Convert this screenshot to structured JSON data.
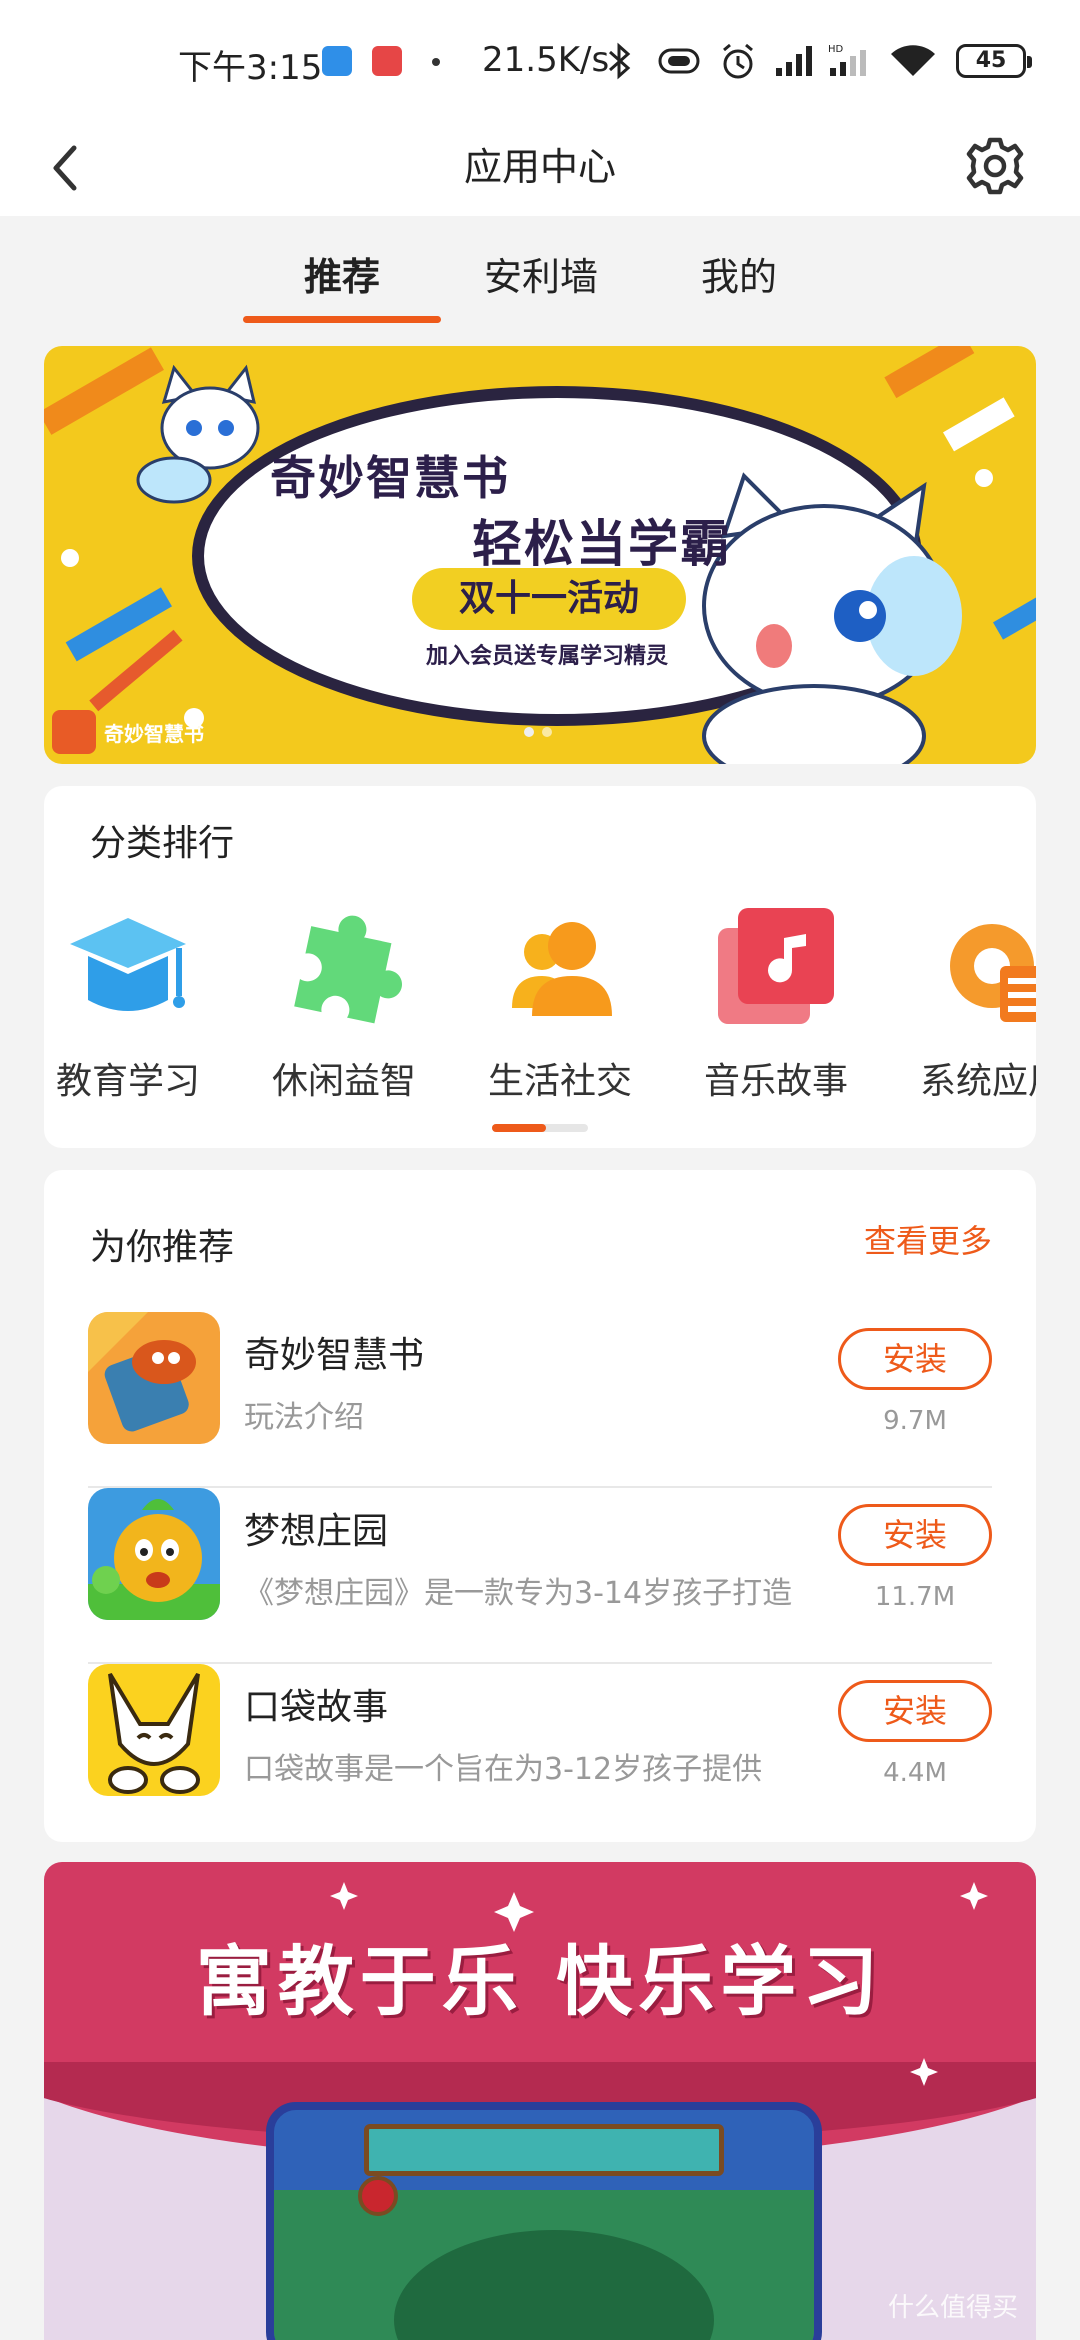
{
  "status_bar": {
    "time": "下午3:15",
    "net_speed": "21.5K/s",
    "network_type": "HD",
    "battery": "45"
  },
  "header": {
    "title": "应用中心",
    "back_icon": "chevron-left-icon",
    "settings_icon": "gear-icon"
  },
  "tabs": [
    {
      "label": "推荐",
      "active": true
    },
    {
      "label": "安利墙",
      "active": false
    },
    {
      "label": "我的",
      "active": false
    }
  ],
  "banner_top": {
    "line1": "奇妙智慧书",
    "line2": "轻松当学霸",
    "event": "双十一活动",
    "subtitle": "加入会员送专属学习精灵",
    "logo_text": "奇妙智慧书",
    "page_index": 1,
    "page_count": 2
  },
  "categories": {
    "title": "分类排行",
    "items": [
      {
        "label": "教育学习",
        "icon": "graduation-cap-icon",
        "color": "#3ea6e8"
      },
      {
        "label": "休闲益智",
        "icon": "puzzle-icon",
        "color": "#5fd86e"
      },
      {
        "label": "生活社交",
        "icon": "people-icon",
        "color": "#f7a21c"
      },
      {
        "label": "音乐故事",
        "icon": "music-note-icon",
        "color": "#ec4a57"
      },
      {
        "label": "系统应用",
        "icon": "gear-document-icon",
        "color": "#f4922a"
      }
    ]
  },
  "recommend": {
    "title": "为你推荐",
    "see_more": "查看更多",
    "apps": [
      {
        "name": "奇妙智慧书",
        "desc": "玩法介绍",
        "install": "安装",
        "size": "9.7M"
      },
      {
        "name": "梦想庄园",
        "desc": "《梦想庄园》是一款专为3-14岁孩子打造",
        "install": "安装",
        "size": "11.7M"
      },
      {
        "name": "口袋故事",
        "desc": "口袋故事是一个旨在为3-12岁孩子提供",
        "install": "安装",
        "size": "4.4M"
      }
    ]
  },
  "banner_bottom": {
    "slogan": "寓教于乐 快乐学习"
  },
  "watermark": "什么值得买",
  "colors": {
    "accent": "#ee5a1a",
    "banner_yellow": "#f3c91d",
    "banner_red": "#d23a62"
  }
}
